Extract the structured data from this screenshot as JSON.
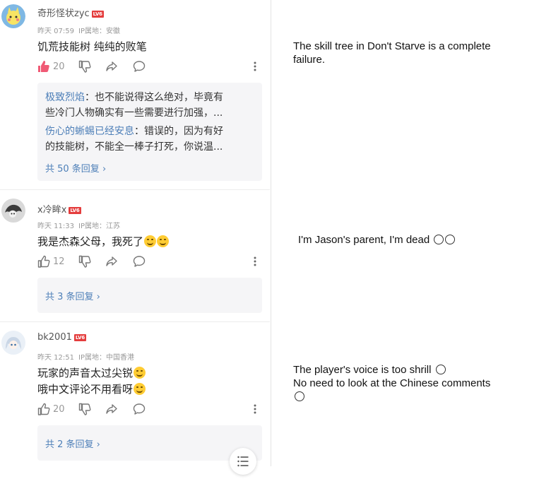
{
  "comments": [
    {
      "username": "奇形怪状zyc",
      "level": "LV6",
      "time": "昨天 07:59",
      "ip": "IP属地：安徽",
      "text": "饥荒技能树 纯纯的败笔",
      "likes": "20",
      "liked": true,
      "replies": [
        {
          "user": "极致烈焰",
          "sep": "：",
          "text": "也不能说得这么绝对，毕竟有",
          "cont": "些冷门人物确实有一些需要进行加强，..."
        },
        {
          "user": "伤心的蜥蜴已经安息",
          "sep": "：",
          "text": "错误的，因为有好",
          "cont": "的技能树，不能全一棒子打死，你说温..."
        }
      ],
      "reply_total": "共 50 条回复 ›"
    },
    {
      "username": "x冷眸x",
      "level": "LV6",
      "time": "昨天 11:33",
      "ip": "IP属地：江苏",
      "text": "我是杰森父母，我死了",
      "likes": "12",
      "liked": false,
      "reply_total": "共 3 条回复 ›"
    },
    {
      "username": "bk2001",
      "level": "LV6",
      "time": "昨天 12:51",
      "ip": "IP属地：中国香港",
      "text_line1": "玩家的声音太过尖锐",
      "text_line2": "哦中文评论不用看呀",
      "likes": "20",
      "liked": false,
      "reply_total": "共 2 条回复 ›"
    }
  ],
  "translations": {
    "t1_line1": "The skill tree in Don't Starve is a complete",
    "t1_line2": "failure.",
    "t2": "I'm Jason's parent, I'm dead",
    "t3_line1": "The player's voice is too shrill",
    "t3_line2": "No need to look at the Chinese comments"
  },
  "icons": [
    "like-icon",
    "dislike-icon",
    "share-icon",
    "comment-icon",
    "more-icon",
    "menu-icon",
    "emoji-icon"
  ],
  "colors": {
    "accent": "#4d7fb8",
    "badge": "#e43d3d",
    "liked": "#f05a75",
    "reply_bg": "#f5f5f7"
  }
}
